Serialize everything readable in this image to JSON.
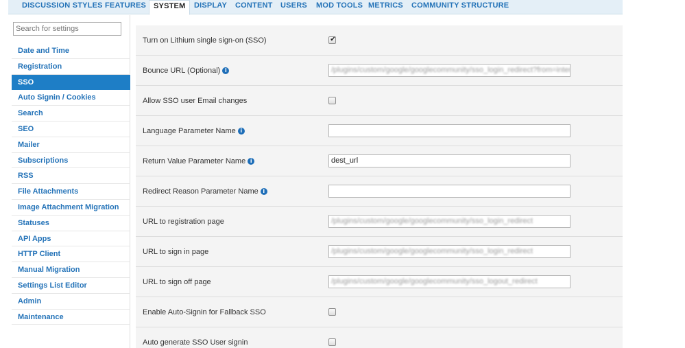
{
  "tabs": [
    {
      "label": "DISCUSSION STYLES"
    },
    {
      "label": "FEATURES"
    },
    {
      "label": "SYSTEM"
    },
    {
      "label": "DISPLAY"
    },
    {
      "label": "CONTENT"
    },
    {
      "label": "USERS"
    },
    {
      "label": "MOD TOOLS"
    },
    {
      "label": "METRICS"
    },
    {
      "label": "COMMUNITY STRUCTURE"
    }
  ],
  "active_tab": "SYSTEM",
  "sidebar": {
    "search_placeholder": "Search for settings",
    "items": [
      {
        "label": "Date and Time"
      },
      {
        "label": "Registration"
      },
      {
        "label": "SSO"
      },
      {
        "label": "Auto Signin / Cookies"
      },
      {
        "label": "Search"
      },
      {
        "label": "SEO"
      },
      {
        "label": "Mailer"
      },
      {
        "label": "Subscriptions"
      },
      {
        "label": "RSS"
      },
      {
        "label": "File Attachments"
      },
      {
        "label": "Image Attachment Migration"
      },
      {
        "label": "Statuses"
      },
      {
        "label": "API Apps"
      },
      {
        "label": "HTTP Client"
      },
      {
        "label": "Manual Migration"
      },
      {
        "label": "Settings List Editor"
      },
      {
        "label": "Admin"
      },
      {
        "label": "Maintenance"
      }
    ],
    "active_item": "SSO"
  },
  "settings": [
    {
      "label": "Turn on Lithium single sign-on (SSO)",
      "type": "checkbox",
      "checked": true
    },
    {
      "label": "Bounce URL (Optional)",
      "info": true,
      "type": "text",
      "value": "/plugins/custom/google/googlecommunity/sso_login_redirect?from=intercommunity",
      "obscured": true
    },
    {
      "label": "Allow SSO user Email changes",
      "type": "checkbox",
      "checked": false
    },
    {
      "label": "Language Parameter Name",
      "info": true,
      "type": "text",
      "value": ""
    },
    {
      "label": "Return Value Parameter Name",
      "info": true,
      "type": "text",
      "value": "dest_url"
    },
    {
      "label": "Redirect Reason Parameter Name",
      "info": true,
      "type": "text",
      "value": ""
    },
    {
      "label": "URL to registration page",
      "type": "text",
      "value": "/plugins/custom/google/googlecommunity/sso_login_redirect",
      "obscured": true
    },
    {
      "label": "URL to sign in page",
      "type": "text",
      "value": "/plugins/custom/google/googlecommunity/sso_login_redirect",
      "obscured": true
    },
    {
      "label": "URL to sign off page",
      "type": "text",
      "value": "/plugins/custom/google/googlecommunity/sso_logout_redirect",
      "obscured": true
    },
    {
      "label": "Enable Auto-Signin for Fallback SSO",
      "type": "checkbox",
      "checked": false
    },
    {
      "label": "Auto generate SSO User signin",
      "type": "checkbox",
      "checked": false
    }
  ],
  "icons": {
    "info": "info-icon",
    "checkmark": "checkmark-icon"
  },
  "colors": {
    "accent": "#2473b8",
    "active_bg": "#1e7ec6",
    "tabbar_bg": "#e4eff7",
    "panel_bg": "#f4f4f4"
  }
}
